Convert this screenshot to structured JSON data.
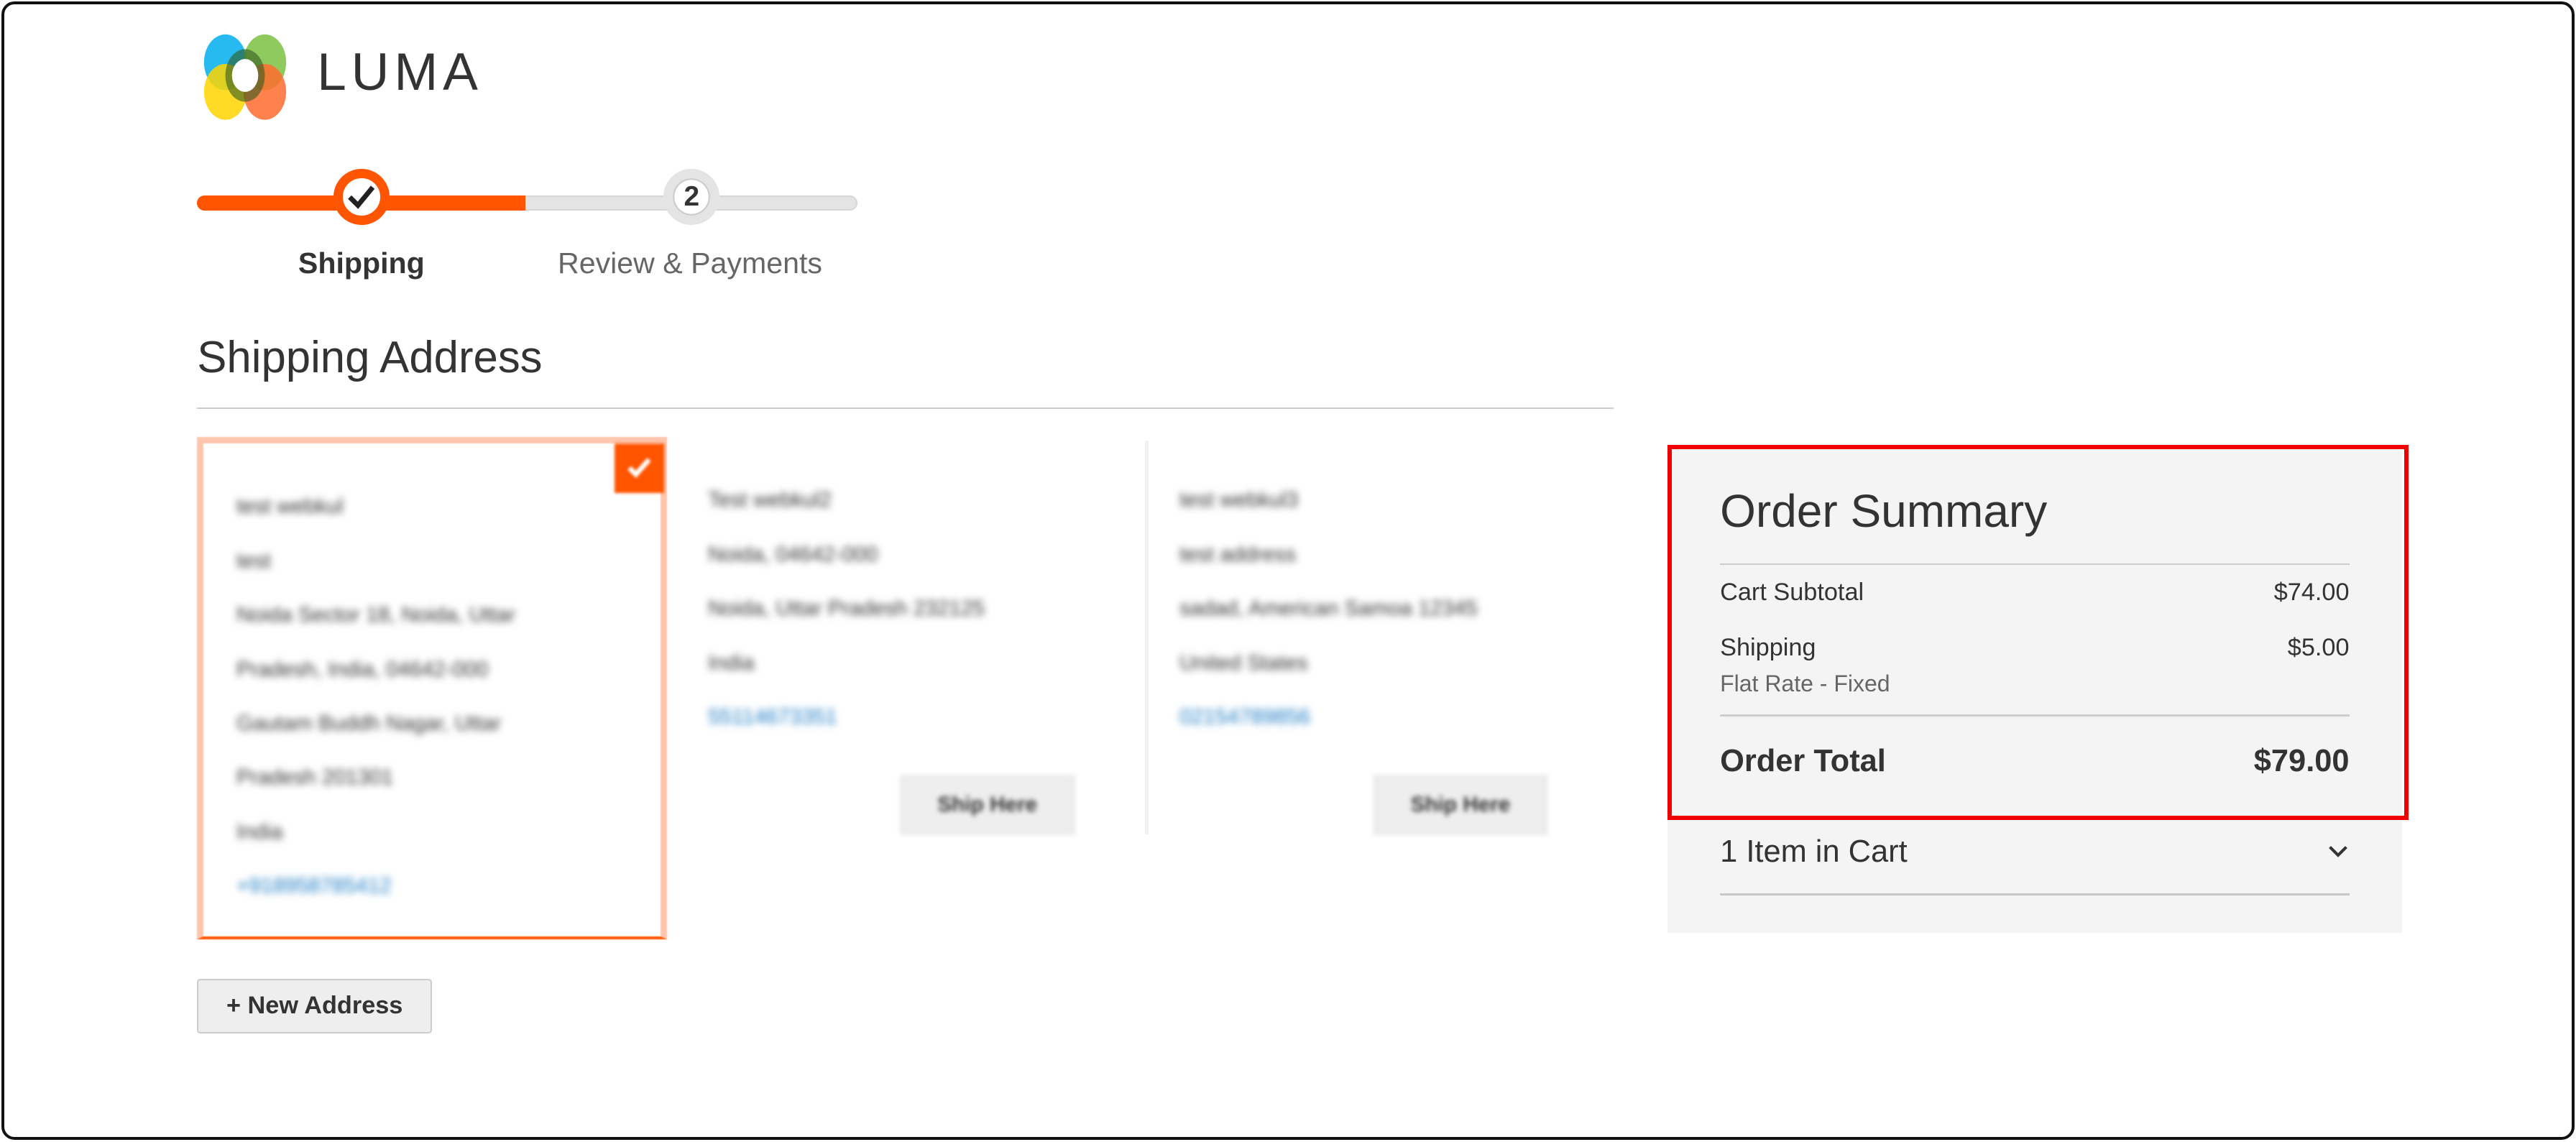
{
  "brand": {
    "name": "LUMA",
    "logo_colors": [
      "#00aeef",
      "#7ac142",
      "#ffd500",
      "#ff6c2f"
    ]
  },
  "colors": {
    "accent": "#ff5501",
    "inactive": "#e4e4e4",
    "link": "#1979c3",
    "summary_bg": "#f4f4f4",
    "highlight": "#ee0000"
  },
  "progress": {
    "steps": [
      {
        "number": "1",
        "label": "Shipping",
        "icon": "check-icon",
        "status": "complete"
      },
      {
        "number": "2",
        "label": "Review & Payments",
        "status": "pending"
      }
    ]
  },
  "shipping": {
    "title": "Shipping Address",
    "addresses": [
      {
        "selected": true,
        "lines": [
          "test webkul",
          "test",
          "Noida Sector 18, Noida, Uttar",
          "Pradesh, India, 04642-000",
          "Gautam Buddh Nagar, Uttar",
          "Pradesh 201301",
          "India"
        ],
        "phone": "+918958785412"
      },
      {
        "selected": false,
        "lines": [
          "Test webkul2",
          "Noida, 04642-000",
          "Noida, Uttar Pradesh 232125",
          "India"
        ],
        "phone": "55114673351",
        "button": "Ship Here"
      },
      {
        "selected": false,
        "lines": [
          "test webkul3",
          "test address",
          "sadad, American Samoa 12345",
          "United States"
        ],
        "phone": "02154789856",
        "button": "Ship Here"
      }
    ],
    "new_address_label": "+ New Address"
  },
  "summary": {
    "title": "Order Summary",
    "subtotal_label": "Cart Subtotal",
    "subtotal": "$74.00",
    "shipping_label": "Shipping",
    "shipping_method": "Flat Rate - Fixed",
    "shipping": "$5.00",
    "total_label": "Order Total",
    "total": "$79.00",
    "items_label": "1 Item in Cart"
  }
}
